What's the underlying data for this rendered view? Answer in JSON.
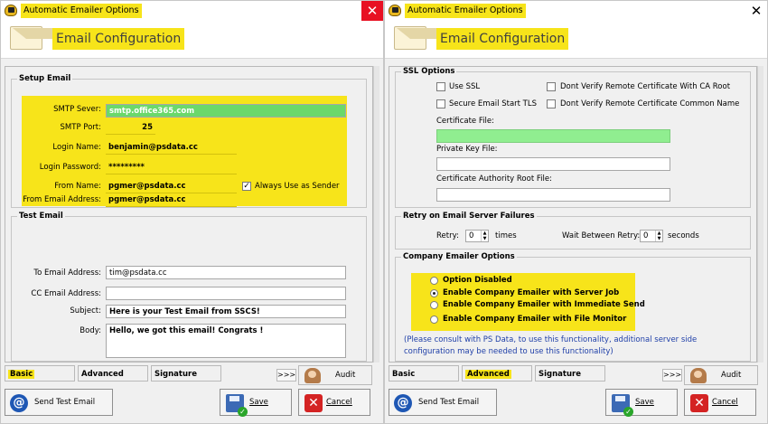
{
  "left": {
    "window_title": "Automatic Emailer Options",
    "header_title": "Email Configuration",
    "setup": {
      "legend": "Setup Email",
      "smtp_server_label": "SMTP Sever:",
      "smtp_server_value": "smtp.office365.com",
      "smtp_port_label": "SMTP Port:",
      "smtp_port_value": "25",
      "login_name_label": "Login Name:",
      "login_name_value": "benjamin@psdata.cc",
      "login_password_label": "Login Password:",
      "login_password_value": "*********",
      "from_name_label": "From Name:",
      "from_name_value": "pgmer@psdata.cc",
      "always_sender_label": "Always Use as Sender",
      "always_sender_checked": true,
      "from_address_label": "From Email Address:",
      "from_address_value": "pgmer@psdata.cc"
    },
    "test": {
      "legend": "Test Email",
      "to_label": "To Email Address:",
      "to_value": "tim@psdata.cc",
      "cc_label": "CC Email Address:",
      "cc_value": "",
      "subject_label": "Subject:",
      "subject_value": "Here is your Test Email from SSCS!",
      "body_label": "Body:",
      "body_value": "Hello, we got this email! Congrats !"
    },
    "tabs": [
      "Basic",
      "Advanced",
      "Signature"
    ],
    "nav_label": ">>>",
    "audit_label": "Audit",
    "send_test_label": "Send Test Email",
    "save_label": "Save",
    "cancel_label": "Cancel",
    "close_glyph": "✕"
  },
  "right": {
    "window_title": "Automatic Emailer Options",
    "header_title": "Email Configuration",
    "ssl": {
      "legend": "SSL Options",
      "use_ssl": "Use SSL",
      "dont_verify_ca": "Dont Verify Remote Certificate With CA Root",
      "secure_tls": "Secure Email Start TLS",
      "dont_verify_cn": "Dont Verify Remote Certificate Common Name",
      "cert_file_label": "Certificate File:",
      "cert_file_value": "",
      "private_key_label": "Private Key File:",
      "private_key_value": "",
      "ca_root_label": "Certificate Authority Root File:",
      "ca_root_value": ""
    },
    "retry": {
      "legend": "Retry on Email Server Failures",
      "retry_label": "Retry:",
      "retry_value": "0",
      "times_label": "times",
      "wait_label": "Wait Between Retry:",
      "wait_value": "0",
      "seconds_label": "seconds"
    },
    "company": {
      "legend": "Company Emailer Options",
      "options": [
        "Option Disabled",
        "Enable Company Emailer with Server Job",
        "Enable Company Emailer with Immediate Send",
        "Enable Company Emailer with File Monitor"
      ],
      "selected": "Enable Company Emailer with Server Job",
      "note": "(Please consult with PS Data, to use this functionality, additional server side configuration may be needed to use this functionality)"
    },
    "tabs": [
      "Basic",
      "Advanced",
      "Signature"
    ],
    "nav_label": ">>>",
    "audit_label": "Audit",
    "send_test_label": "Send Test Email",
    "save_label": "Save",
    "cancel_label": "Cancel",
    "close_glyph": "✕"
  },
  "colors": {
    "highlight": "#f7e41a",
    "smtp_field": "#6bd86b",
    "cert_field": "#90ee90",
    "close_red": "#e81123",
    "note_blue": "#1f3fa8"
  }
}
